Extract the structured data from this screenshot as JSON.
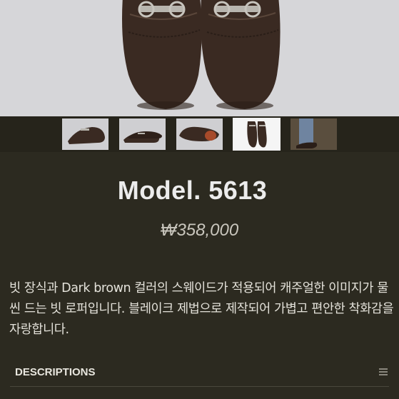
{
  "product": {
    "title": "Model. 5613",
    "price": "₩358,000",
    "description": "빗 장식과 Dark brown 컬러의 스웨이드가 적용되어 캐주얼한 이미지가 물씬 드는 빗 로퍼입니다. 블레이크 제법으로 제작되어 가볍고 편안한 착화감을 자랑합니다."
  },
  "gallery": {
    "active_index": 3,
    "thumbnails": [
      "side-view",
      "pair-side-view",
      "sole-view",
      "top-view",
      "worn-view"
    ]
  },
  "sections": {
    "descriptions_label": "DESCRIPTIONS"
  },
  "colors": {
    "background": "#2c2a20",
    "hero_background": "#d6d6d9",
    "suede": "#3a2a22"
  }
}
